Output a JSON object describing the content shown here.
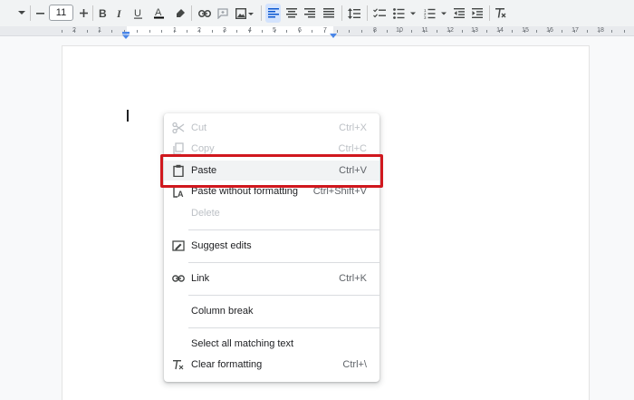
{
  "toolbar": {
    "font_size": "11",
    "icons": [
      "chevron-down-icon",
      "minus-icon",
      "plus-icon",
      "bold-icon",
      "italic-icon",
      "underline-icon",
      "text-color-icon",
      "highlighter-icon",
      "link-icon",
      "comment-icon",
      "image-icon",
      "align-left-icon",
      "align-center-icon",
      "align-right-icon",
      "justify-icon",
      "line-spacing-icon",
      "checklist-icon",
      "bulleted-list-icon",
      "numbered-list-icon",
      "decrease-indent-icon",
      "increase-indent-icon",
      "clear-formatting-icon"
    ],
    "text_color_bar": "#000000",
    "active_icon_bg": "#d3e3fd"
  },
  "ruler": {
    "labels": [
      "2",
      "1",
      "1",
      "2",
      "3",
      "4",
      "5",
      "6",
      "7",
      "8",
      "10",
      "11",
      "12",
      "13",
      "14",
      "15",
      "16",
      "17",
      "18"
    ],
    "marker_color": "#4a86e8"
  },
  "context_menu": {
    "items": [
      {
        "label": "Cut",
        "shortcut": "Ctrl+X",
        "icon": "scissors-icon",
        "disabled": true
      },
      {
        "label": "Copy",
        "shortcut": "Ctrl+C",
        "icon": "copy-icon",
        "disabled": true
      },
      {
        "label": "Paste",
        "shortcut": "Ctrl+V",
        "icon": "clipboard-icon",
        "disabled": false,
        "highlighted": true
      },
      {
        "label": "Paste without formatting",
        "shortcut": "Ctrl+Shift+V",
        "icon": "paste-plain-icon",
        "disabled": false
      },
      {
        "label": "Delete",
        "shortcut": "",
        "icon": "",
        "disabled": true
      },
      {
        "label": "Suggest edits",
        "shortcut": "",
        "icon": "suggest-edits-icon",
        "disabled": false
      },
      {
        "label": "Link",
        "shortcut": "Ctrl+K",
        "icon": "link-icon",
        "disabled": false
      },
      {
        "label": "Column break",
        "shortcut": "",
        "icon": "",
        "disabled": false
      },
      {
        "label": "Select all matching text",
        "shortcut": "",
        "icon": "",
        "disabled": false
      },
      {
        "label": "Clear formatting",
        "shortcut": "Ctrl+\\",
        "icon": "clear-formatting-icon",
        "disabled": false
      }
    ]
  },
  "highlight_color": "#d0181e"
}
